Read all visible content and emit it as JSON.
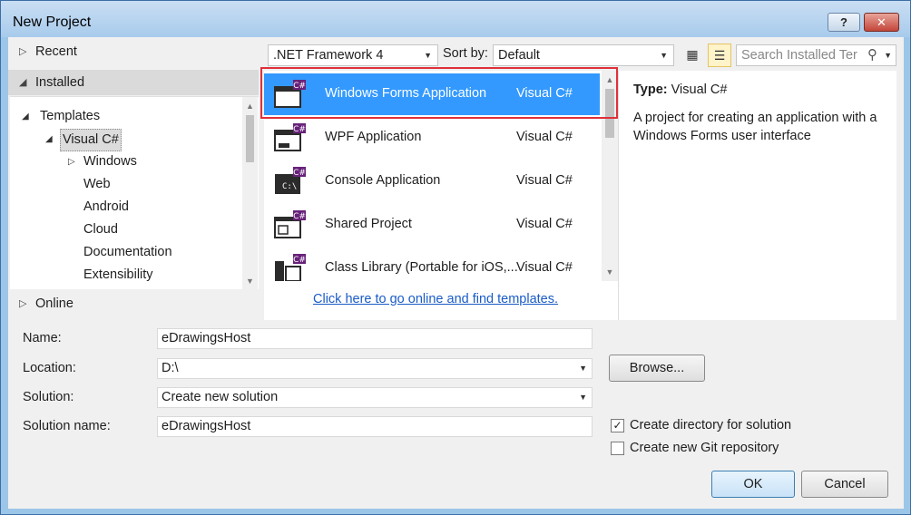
{
  "window": {
    "title": "New Project",
    "help_label": "?",
    "close_label": "✕"
  },
  "nav": {
    "recent": "Recent",
    "installed": "Installed",
    "online": "Online",
    "tree": {
      "templates": "Templates",
      "visual_csharp": "Visual C#",
      "children": [
        "Windows",
        "Web",
        "Android",
        "Cloud",
        "Documentation",
        "Extensibility"
      ]
    }
  },
  "toolbar": {
    "framework": ".NET Framework 4",
    "sort_label": "Sort by:",
    "sort_value": "Default",
    "search_placeholder": "Search Installed Ter"
  },
  "templates": [
    {
      "name": "Windows Forms Application",
      "lang": "Visual C#",
      "icon": "winforms-icon",
      "selected": true
    },
    {
      "name": "WPF Application",
      "lang": "Visual C#",
      "icon": "wpf-icon",
      "selected": false
    },
    {
      "name": "Console Application",
      "lang": "Visual C#",
      "icon": "console-icon",
      "selected": false
    },
    {
      "name": "Shared Project",
      "lang": "Visual C#",
      "icon": "shared-project-icon",
      "selected": false
    },
    {
      "name": "Class Library (Portable for iOS,...",
      "lang": "Visual C#",
      "icon": "class-library-icon",
      "selected": false
    }
  ],
  "online_link": "Click here to go online and find templates.",
  "details": {
    "type_label": "Type:",
    "type_value": "Visual C#",
    "description": "A project for creating an application with a Windows Forms user interface"
  },
  "form": {
    "name_label": "Name:",
    "name_value": "eDrawingsHost",
    "location_label": "Location:",
    "location_value": "D:\\",
    "solution_label": "Solution:",
    "solution_value": "Create new solution",
    "solution_name_label": "Solution name:",
    "solution_name_value": "eDrawingsHost",
    "browse_label": "Browse...",
    "create_dir_label": "Create directory for solution",
    "create_dir_checked": true,
    "git_label": "Create new Git repository",
    "git_checked": false
  },
  "buttons": {
    "ok": "OK",
    "cancel": "Cancel"
  },
  "colors": {
    "selection": "#3399ff",
    "highlight_box": "#e0303a",
    "link": "#1a5cc8",
    "csharp_badge": "#68217a"
  }
}
